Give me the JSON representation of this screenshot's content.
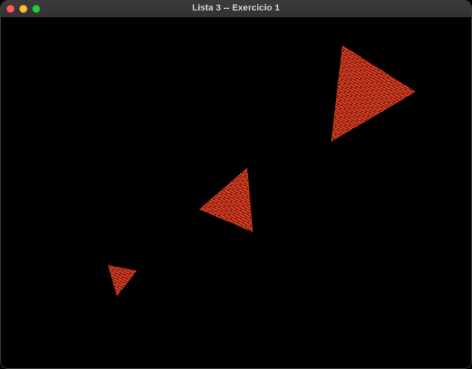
{
  "window": {
    "title": "Lista 3 -- Exercicio 1",
    "controls": {
      "close_color": "#ff5f57",
      "minimize_color": "#febc2e",
      "maximize_color": "#28c840"
    }
  },
  "scene": {
    "background": "#000000",
    "texture": {
      "name": "brick-texture",
      "brick_color": "#c8321c",
      "highlight_color": "#e65a34",
      "mortar_color": "#6e1208"
    },
    "shapes": [
      {
        "name": "triangle-large",
        "kind": "textured-triangle"
      },
      {
        "name": "triangle-medium",
        "kind": "textured-triangle"
      },
      {
        "name": "triangle-small",
        "kind": "textured-triangle"
      }
    ]
  }
}
